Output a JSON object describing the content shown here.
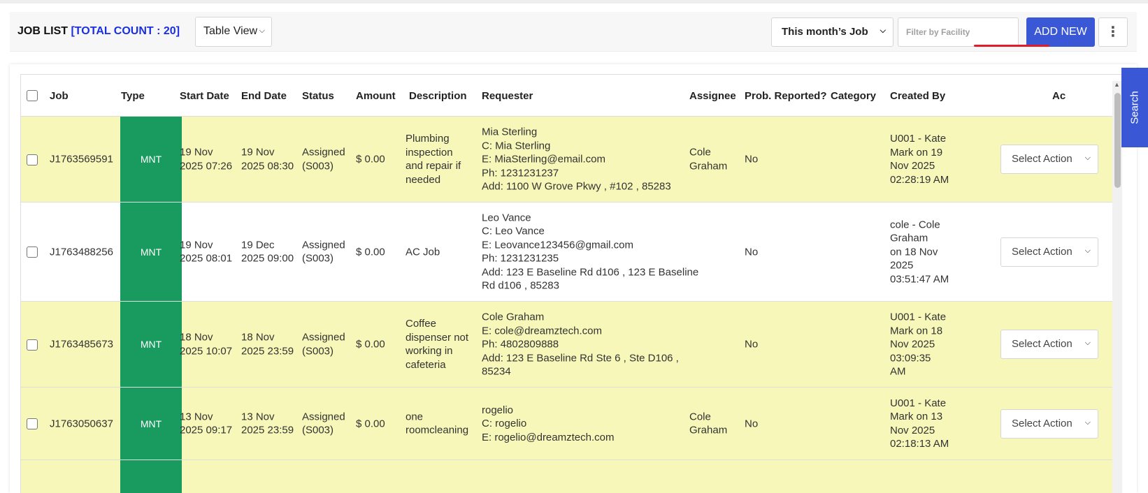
{
  "header": {
    "title": "JOB LIST",
    "total_count_label": "[TOTAL COUNT : 20]",
    "view_select": "Table View",
    "period_select": "This month’s Job",
    "facility_placeholder": "Filter by Facility",
    "add_button": "ADD NEW",
    "more_icon": "⋮",
    "accent_color": "#3a58d6",
    "count_color": "#1a2fe0"
  },
  "search_tab": "Search",
  "table": {
    "columns": [
      "Job",
      "Type",
      "Start Date",
      "End Date",
      "Status",
      "Amount",
      "Description",
      "Requester",
      "Assignee",
      "Prob. Reported?",
      "Category",
      "Created By",
      "",
      "Ac"
    ],
    "type_color": "#199a5e",
    "row_highlight_color": "#f6f7b8",
    "rows": [
      {
        "job": "J1763569591",
        "type": "MNT",
        "start": [
          "19 Nov",
          "2025 07:26"
        ],
        "end": [
          "19 Nov",
          "2025 08:30"
        ],
        "status": [
          "Assigned",
          "(S003)"
        ],
        "amount": "$ 0.00",
        "description": [
          "Plumbing",
          "inspection",
          "and repair if",
          "needed"
        ],
        "requester": [
          "Mia Sterling",
          "C: Mia Sterling",
          "E: MiaSterling@email.com",
          "Ph: 1231231237",
          "Add: 1100 W Grove Pkwy , #102 , 85283"
        ],
        "assignee": [
          "Cole",
          "Graham"
        ],
        "reported": "No",
        "category": "",
        "created_by": [
          "U001 - Kate",
          "Mark on 19",
          "Nov 2025",
          "02:28:19 AM"
        ],
        "action": "Select Action",
        "highlight": true
      },
      {
        "job": "J1763488256",
        "type": "MNT",
        "start": [
          "19 Nov",
          "2025 08:01"
        ],
        "end": [
          "19 Dec",
          "2025 09:00"
        ],
        "status": [
          "Assigned",
          "(S003)"
        ],
        "amount": "$ 0.00",
        "description": [
          "AC Job"
        ],
        "requester": [
          "Leo Vance",
          "C: Leo Vance",
          "E: Leovance123456@gmail.com",
          "Ph: 1231231235",
          "Add: 123 E Baseline Rd d106 , 123 E Baseline",
          "Rd d106 , 85283"
        ],
        "assignee": [],
        "reported": "No",
        "category": "",
        "created_by": [
          "cole - Cole",
          "Graham",
          "on 18 Nov",
          "2025",
          "03:51:47 AM"
        ],
        "action": "Select Action",
        "highlight": false
      },
      {
        "job": "J1763485673",
        "type": "MNT",
        "start": [
          "18 Nov",
          "2025 10:07"
        ],
        "end": [
          "18 Nov",
          "2025 23:59"
        ],
        "status": [
          "Assigned",
          "(S003)"
        ],
        "amount": "$ 0.00",
        "description": [
          "Coffee",
          "dispenser not",
          "working in",
          "cafeteria"
        ],
        "requester": [
          "Cole Graham",
          "E: cole@dreamztech.com",
          "Ph: 4802809888",
          "Add: 123 E Baseline Rd Ste 6 , Ste D106 ,",
          "85234"
        ],
        "assignee": [],
        "reported": "No",
        "category": "",
        "created_by": [
          "U001 - Kate",
          "Mark on 18",
          "Nov 2025",
          "03:09:35",
          "AM"
        ],
        "action": "Select Action",
        "highlight": true
      },
      {
        "job": "J1763050637",
        "type": "MNT",
        "start": [
          "13 Nov",
          "2025 09:17"
        ],
        "end": [
          "13 Nov",
          "2025 23:59"
        ],
        "status": [
          "Assigned",
          "(S003)"
        ],
        "amount": "$ 0.00",
        "description": [
          "one",
          "roomcleaning"
        ],
        "requester": [
          "rogelio",
          "C: rogelio",
          "E: rogelio@dreamztech.com"
        ],
        "assignee": [
          "Cole",
          "Graham"
        ],
        "reported": "No",
        "category": "",
        "created_by": [
          "U001 - Kate",
          "Mark on 13",
          "Nov 2025",
          "02:18:13 AM"
        ],
        "action": "Select Action",
        "highlight": true
      }
    ]
  }
}
